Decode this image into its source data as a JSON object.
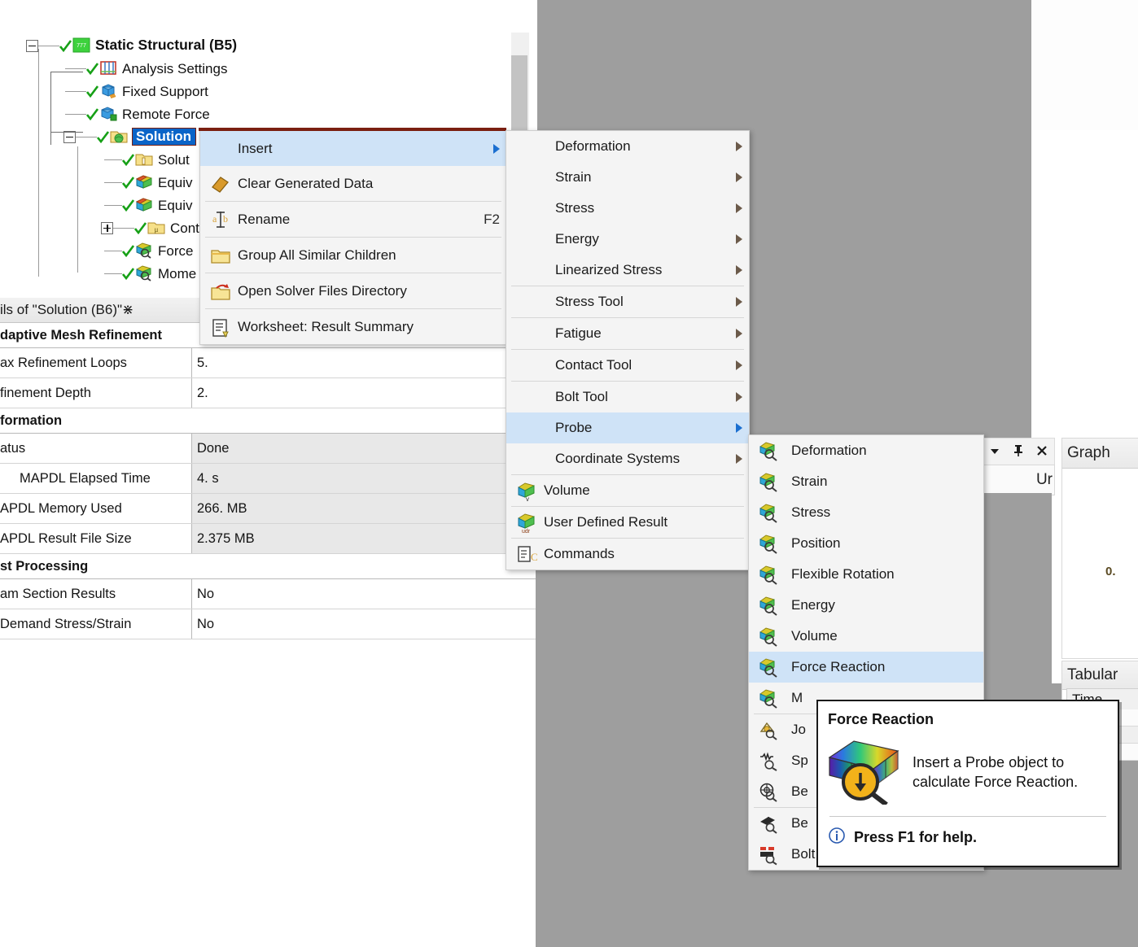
{
  "tree": {
    "items": [
      {
        "label": "Static Structural (B5)",
        "icon": "static-structural-icon",
        "state": "checked",
        "expander": "minus",
        "bold": true,
        "selected": false
      },
      {
        "label": "Analysis Settings",
        "icon": "analysis-settings-icon",
        "state": "checked",
        "expander": "none",
        "bold": false,
        "selected": false
      },
      {
        "label": "Fixed Support",
        "icon": "fixed-support-icon",
        "state": "checked",
        "expander": "none",
        "bold": false,
        "selected": false
      },
      {
        "label": "Remote Force",
        "icon": "remote-force-icon",
        "state": "checked",
        "expander": "none",
        "bold": false,
        "selected": false
      },
      {
        "label": "Solution",
        "icon": "solution-folder-icon",
        "state": "checked",
        "expander": "minus",
        "bold": false,
        "selected": true
      },
      {
        "label": "Solut",
        "icon": "solution-information-icon",
        "state": "checked",
        "expander": "none",
        "bold": false,
        "selected": false
      },
      {
        "label": "Equiv",
        "icon": "result-icon",
        "state": "checked",
        "expander": "none",
        "bold": false,
        "selected": false
      },
      {
        "label": "Equiv",
        "icon": "result-icon",
        "state": "checked",
        "expander": "none",
        "bold": false,
        "selected": false
      },
      {
        "label": "Cont",
        "icon": "contact-tool-folder-icon",
        "state": "checked",
        "expander": "plus",
        "bold": false,
        "selected": false
      },
      {
        "label": "Force",
        "icon": "probe-result-icon",
        "state": "checked",
        "expander": "none",
        "bold": false,
        "selected": false
      },
      {
        "label": "Mome",
        "icon": "probe-result-icon",
        "state": "checked",
        "expander": "none",
        "bold": false,
        "selected": false
      }
    ]
  },
  "details": {
    "title": "ils of \"Solution (B6)\"",
    "groups": [
      {
        "heading": "daptive Mesh Refinement",
        "rows": [
          {
            "key": "ax Refinement Loops",
            "value": "5.",
            "readonly": false
          },
          {
            "key": "finement Depth",
            "value": "2.",
            "readonly": false
          }
        ]
      },
      {
        "heading": "formation",
        "rows": [
          {
            "key": "atus",
            "value": "Done",
            "readonly": true
          },
          {
            "key": "MAPDL Elapsed Time",
            "value": "4. s",
            "readonly": true
          },
          {
            "key": "APDL Memory Used",
            "value": "266. MB",
            "readonly": true
          },
          {
            "key": "APDL Result File Size",
            "value": "2.375 MB",
            "readonly": true
          }
        ]
      },
      {
        "heading": "st Processing",
        "rows": [
          {
            "key": "am Section Results",
            "value": "No",
            "readonly": false
          },
          {
            "key": "Demand Stress/Strain",
            "value": "No",
            "readonly": false
          }
        ]
      }
    ]
  },
  "context_menu": {
    "items": [
      {
        "label": "Insert",
        "shortcut": "",
        "icon": "",
        "arrow": true,
        "highlighted": true,
        "separator_after": false
      },
      {
        "label": "Clear Generated Data",
        "shortcut": "",
        "icon": "eraser-icon",
        "arrow": false,
        "highlighted": false,
        "separator_after": true
      },
      {
        "label": "Rename",
        "shortcut": "F2",
        "icon": "rename-icon",
        "arrow": false,
        "highlighted": false,
        "separator_after": true
      },
      {
        "label": "Group All Similar Children",
        "shortcut": "",
        "icon": "folder-icon",
        "arrow": false,
        "highlighted": false,
        "separator_after": true
      },
      {
        "label": "Open Solver Files Directory",
        "shortcut": "",
        "icon": "open-folder-icon",
        "arrow": false,
        "highlighted": false,
        "separator_after": true
      },
      {
        "label": "Worksheet: Result Summary",
        "shortcut": "",
        "icon": "worksheet-icon",
        "arrow": false,
        "highlighted": false,
        "separator_after": false
      }
    ]
  },
  "insert_menu": {
    "items": [
      {
        "label": "Deformation",
        "icon": "",
        "arrow": true,
        "highlighted": false,
        "separator_after": false
      },
      {
        "label": "Strain",
        "icon": "",
        "arrow": true,
        "highlighted": false,
        "separator_after": false
      },
      {
        "label": "Stress",
        "icon": "",
        "arrow": true,
        "highlighted": false,
        "separator_after": false
      },
      {
        "label": "Energy",
        "icon": "",
        "arrow": true,
        "highlighted": false,
        "separator_after": false
      },
      {
        "label": "Linearized Stress",
        "icon": "",
        "arrow": true,
        "highlighted": false,
        "separator_after": true
      },
      {
        "label": "Stress Tool",
        "icon": "",
        "arrow": true,
        "highlighted": false,
        "separator_after": true
      },
      {
        "label": "Fatigue",
        "icon": "",
        "arrow": true,
        "highlighted": false,
        "separator_after": true
      },
      {
        "label": "Contact Tool",
        "icon": "",
        "arrow": true,
        "highlighted": false,
        "separator_after": true
      },
      {
        "label": "Bolt Tool",
        "icon": "",
        "arrow": true,
        "highlighted": false,
        "separator_after": false
      },
      {
        "label": "Probe",
        "icon": "",
        "arrow": true,
        "highlighted": true,
        "separator_after": false
      },
      {
        "label": "Coordinate Systems",
        "icon": "",
        "arrow": true,
        "highlighted": false,
        "separator_after": true
      },
      {
        "label": "Volume",
        "icon": "volume-result-icon",
        "arrow": false,
        "highlighted": false,
        "separator_after": true
      },
      {
        "label": "User Defined Result",
        "icon": "user-defined-result-icon",
        "arrow": false,
        "highlighted": false,
        "separator_after": true
      },
      {
        "label": "Commands",
        "icon": "commands-icon",
        "arrow": false,
        "highlighted": false,
        "separator_after": false
      }
    ]
  },
  "probe_menu": {
    "items": [
      {
        "label": "Deformation",
        "icon": "probe-icon",
        "highlighted": false,
        "separator_after": false
      },
      {
        "label": "Strain",
        "icon": "probe-icon",
        "highlighted": false,
        "separator_after": false
      },
      {
        "label": "Stress",
        "icon": "probe-icon",
        "highlighted": false,
        "separator_after": false
      },
      {
        "label": "Position",
        "icon": "probe-icon",
        "highlighted": false,
        "separator_after": false
      },
      {
        "label": "Flexible Rotation",
        "icon": "probe-icon",
        "highlighted": false,
        "separator_after": false
      },
      {
        "label": "Energy",
        "icon": "probe-icon",
        "highlighted": false,
        "separator_after": false
      },
      {
        "label": "Volume",
        "icon": "probe-icon",
        "highlighted": false,
        "separator_after": false
      },
      {
        "label": "Force Reaction",
        "icon": "probe-icon",
        "highlighted": true,
        "separator_after": false
      },
      {
        "label": "M",
        "icon": "probe-icon",
        "highlighted": false,
        "separator_after": true
      },
      {
        "label": "Jo",
        "icon": "joint-probe-icon",
        "highlighted": false,
        "separator_after": false
      },
      {
        "label": "Sp",
        "icon": "spring-probe-icon",
        "highlighted": false,
        "separator_after": false
      },
      {
        "label": "Be",
        "icon": "bearing-probe-icon",
        "highlighted": false,
        "separator_after": true
      },
      {
        "label": "Be",
        "icon": "beam-probe-icon",
        "highlighted": false,
        "separator_after": false
      },
      {
        "label": "Bolt Pretension",
        "icon": "bolt-pretension-probe-icon",
        "highlighted": false,
        "separator_after": false
      }
    ]
  },
  "tooltip": {
    "title": "Force Reaction",
    "description_line1": "Insert a Probe object to",
    "description_line2": "calculate Force Reaction.",
    "footer": "Press F1 for help.",
    "icon": "force-reaction-probe-icon"
  },
  "right_panels": {
    "dropdown_icon": "chevron-down-icon",
    "pin_icon": "pin-icon",
    "close_icon": "close-icon",
    "tab_label": "Ur",
    "graph_title": "Graph",
    "graph_axis_zero": "0.",
    "tabular_title": "Tabular",
    "tabular_column": "Time"
  },
  "colors": {
    "selection_blue": "#0a64c8",
    "menu_highlight": "#cfe3f7",
    "viewport_gray": "#9e9e9e",
    "check_green": "#16a016",
    "arrow_brown": "#6b5a4a",
    "arrow_blue": "#1b6fd0"
  }
}
